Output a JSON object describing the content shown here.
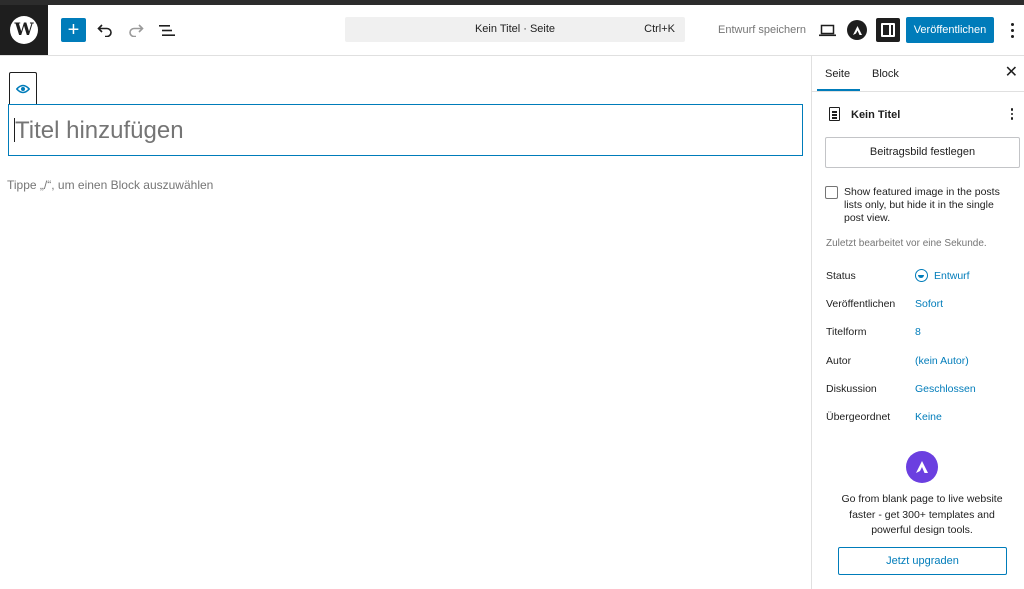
{
  "header": {
    "wp_logo_letter": "W",
    "command": {
      "title": "Kein Titel · Seite",
      "shortcut": "Ctrl+K"
    },
    "save_draft": "Entwurf speichern",
    "publish": "Veröffentlichen",
    "icons": [
      "wordpress-logo",
      "plus-icon",
      "undo-icon",
      "redo-icon",
      "list-view-icon",
      "desktop-preview-icon",
      "astra-icon",
      "settings-sidebar-icon",
      "more-vertical-icon"
    ]
  },
  "editor": {
    "title_placeholder": "Titel hinzufügen",
    "block_hint": "Tippe „/“, um einen Block auszuwählen",
    "icons": [
      "eye-icon"
    ]
  },
  "sidebar": {
    "tabs": [
      "Seite",
      "Block"
    ],
    "document": {
      "title": "Kein Titel"
    },
    "featured_image_button": "Beitragsbild festlegen",
    "checkbox_label": "Show featured image in the posts lists only, but hide it in the single post view.",
    "checkbox_checked": false,
    "last_edited": "Zuletzt bearbeitet vor eine Sekunde.",
    "meta": [
      {
        "label": "Status",
        "value": "Entwurf"
      },
      {
        "label": "Veröffentlichen",
        "value": "Sofort"
      },
      {
        "label": "Titelform",
        "value": "8"
      },
      {
        "label": "Autor",
        "value": "(kein Autor)"
      },
      {
        "label": "Diskussion",
        "value": "Geschlossen"
      },
      {
        "label": "Übergeordnet",
        "value": "Keine"
      }
    ],
    "promo_text": "Go from blank page to live website faster - get 300+ templates and powerful design tools.",
    "upgrade_button": "Jetzt upgraden"
  },
  "colors": {
    "accent": "#007cba",
    "dark": "#1e1e1e",
    "astra": "#6b3fe0",
    "muted": "#757575"
  }
}
